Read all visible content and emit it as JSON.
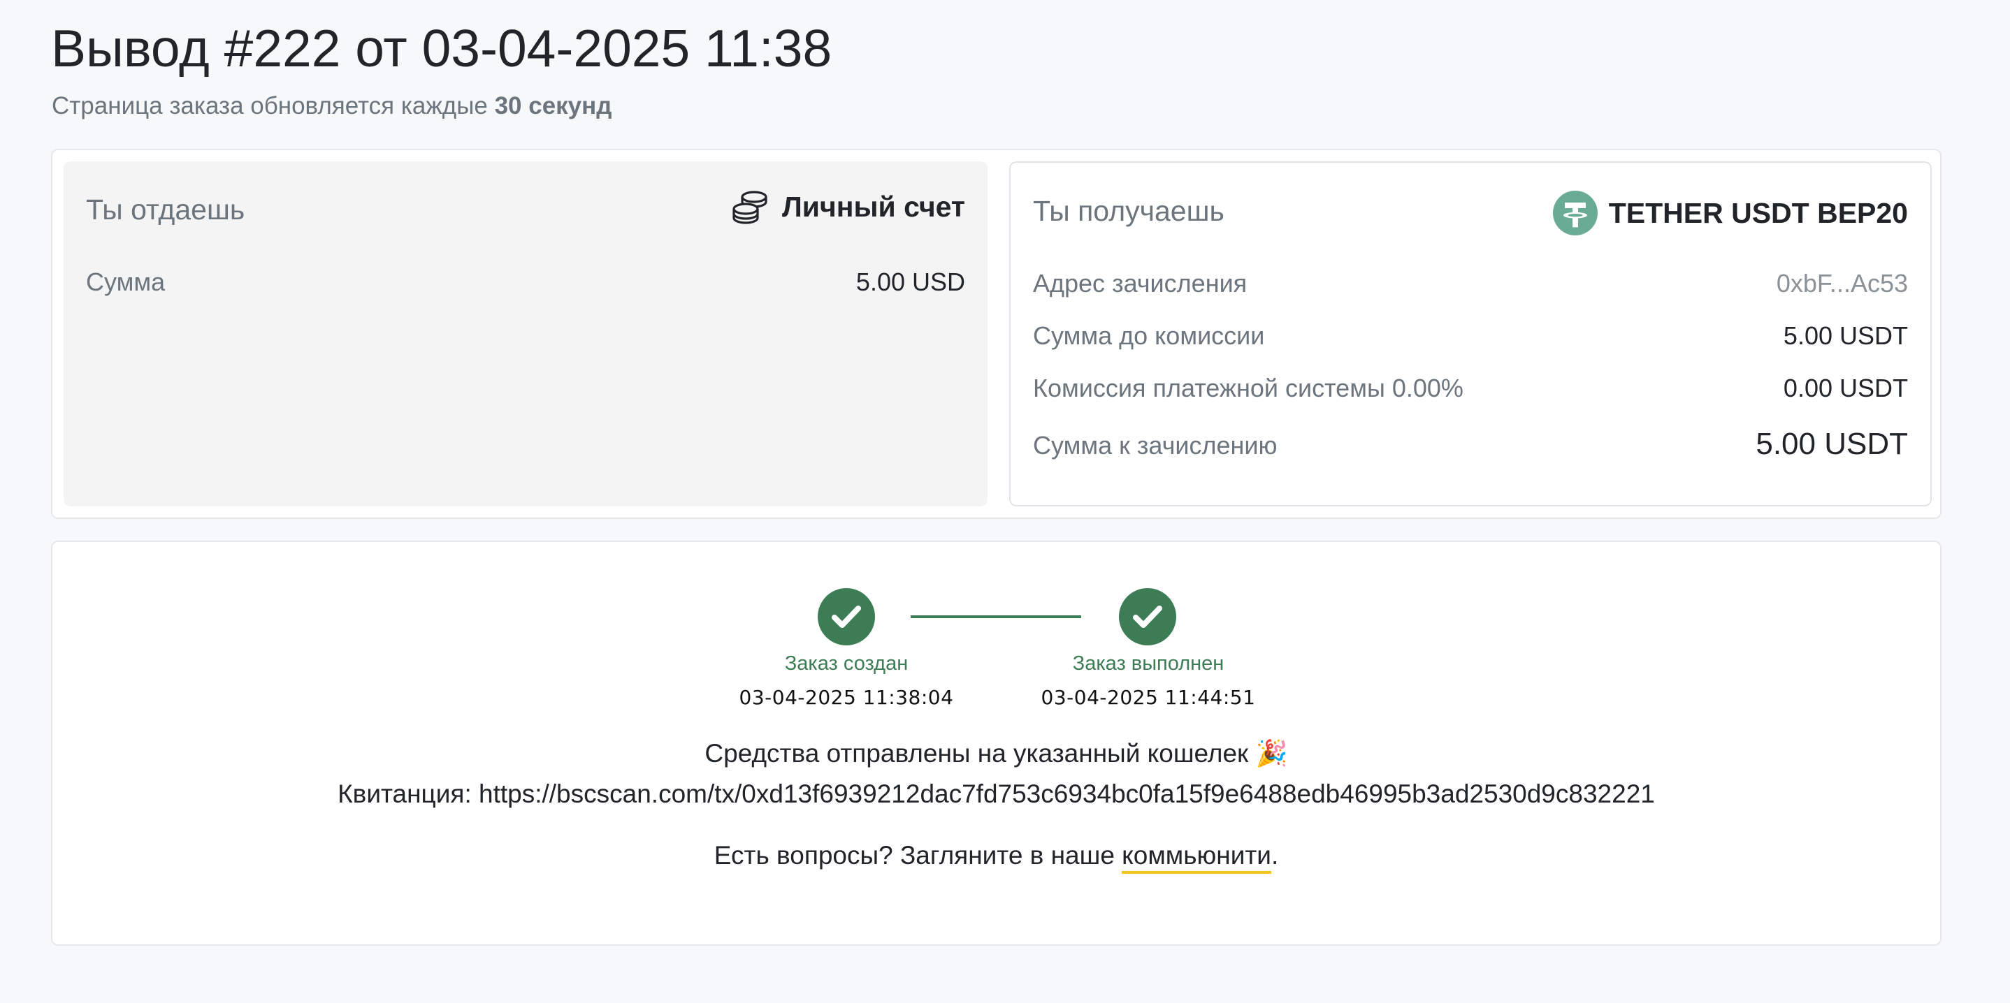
{
  "header": {
    "title_prefix": "Вывод ",
    "order_number": "#222",
    "title_mid": " от ",
    "datetime": "03-04-2025 11:38",
    "refresh_text": "Страница заказа обновляется каждые ",
    "refresh_interval": "30 секунд"
  },
  "give": {
    "heading": "Ты отдаешь",
    "method": "Личный счет",
    "method_icon": "coins-icon",
    "amount_label": "Сумма",
    "amount_value": "5.00 USD"
  },
  "receive": {
    "heading": "Ты получаешь",
    "method": "TETHER USDT BEP20",
    "method_icon": "tether-icon",
    "method_icon_color": "#6aab96",
    "rows": [
      {
        "label": "Адрес зачисления",
        "value": "0xbF...Ac53"
      },
      {
        "label": "Сумма до комиссии",
        "value": "5.00 USDT"
      },
      {
        "label": "Комиссия платежной системы 0.00%",
        "value": "0.00 USDT"
      },
      {
        "label": "Сумма к зачислению",
        "value": "5.00 USDT"
      }
    ]
  },
  "progress": {
    "accent_color": "#3d7d55",
    "steps": [
      {
        "label": "Заказ создан",
        "time": "03-04-2025 11:38:04"
      },
      {
        "label": "Заказ выполнен",
        "time": "03-04-2025 11:44:51"
      }
    ]
  },
  "result": {
    "message": "Средства отправлены на указанный кошелек 🎉",
    "receipt_label": "Квитанция: ",
    "receipt_url": "https://bscscan.com/tx/0xd13f6939212dac7fd753c6934bc0fa15f9e6488edb46995b3ad2530d9c832221",
    "help_prefix": "Есть вопросы? Загляните в наше ",
    "help_link": "коммьюнити",
    "help_suffix": "."
  }
}
